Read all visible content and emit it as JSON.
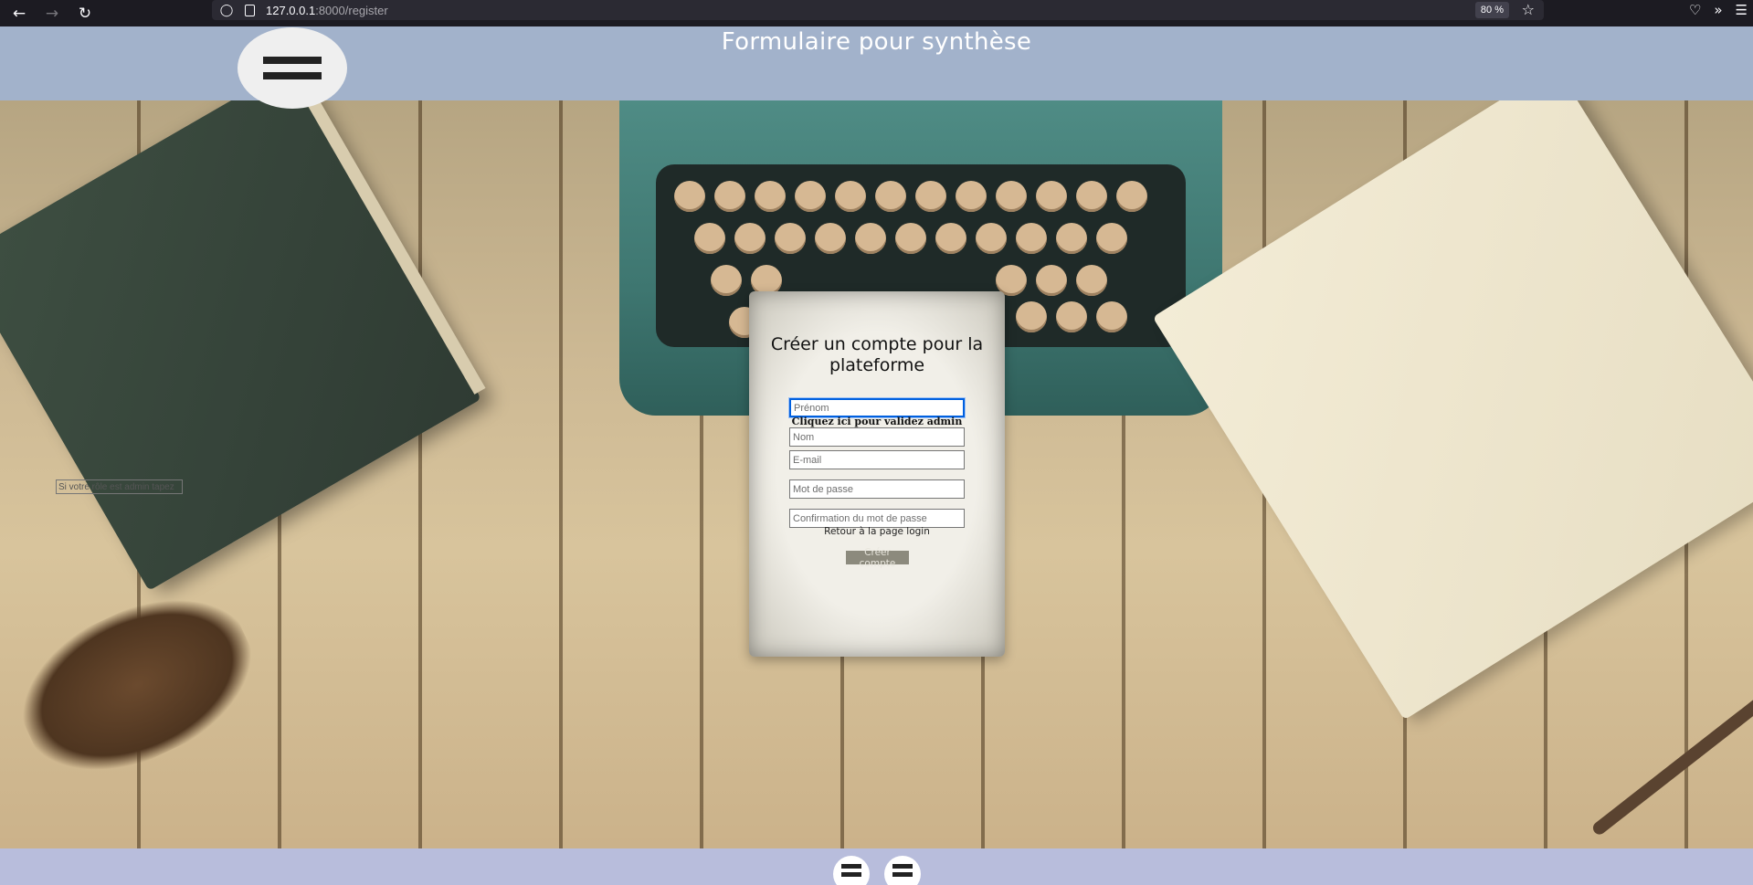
{
  "browser": {
    "url_host": "127.0.0.1",
    "url_rest": ":8000/register",
    "zoom": "80 %"
  },
  "header": {
    "title": "Formulaire pour synthèse"
  },
  "form": {
    "title": "Créer un compte pour la plateforme",
    "firstname_placeholder": "Prénom",
    "lastname_placeholder": "Nom",
    "admin_code_placeholder": "Si votre rôle est admin tapez",
    "admin_link": "Cliquez ici pour validez admin",
    "email_placeholder": "E-mail",
    "password_placeholder": "Mot de passe",
    "password_confirm_placeholder": "Confirmation du mot de passe",
    "login_link": "Retour à la page login",
    "submit_label": "Créer compte"
  },
  "icons": {
    "back": "arrow-left-icon",
    "forward": "arrow-right-icon",
    "reload": "reload-icon",
    "shield": "shield-icon",
    "page": "page-icon",
    "star": "star-icon",
    "pocket": "pocket-icon",
    "extensions": "chevrons-icon",
    "app_menu": "hamburger-icon"
  },
  "colors": {
    "header_bg": "#a2b2cb",
    "footer_bg": "#b8bddc",
    "card_bg": "#f1efe8",
    "submit_bg": "#8c8a7d"
  }
}
